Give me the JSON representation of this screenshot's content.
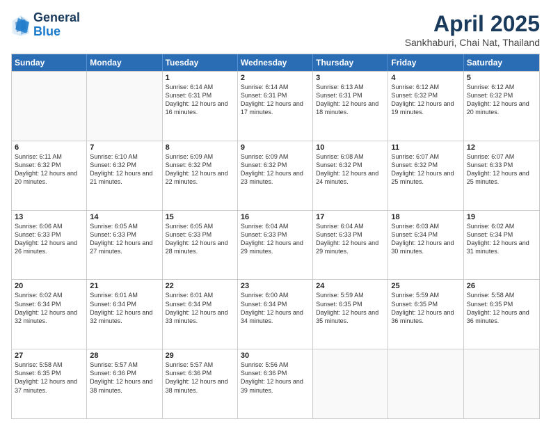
{
  "header": {
    "logo_general": "General",
    "logo_blue": "Blue",
    "title": "April 2025",
    "location": "Sankhaburi, Chai Nat, Thailand"
  },
  "days_of_week": [
    "Sunday",
    "Monday",
    "Tuesday",
    "Wednesday",
    "Thursday",
    "Friday",
    "Saturday"
  ],
  "weeks": [
    [
      {
        "day": "",
        "info": ""
      },
      {
        "day": "",
        "info": ""
      },
      {
        "day": "1",
        "info": "Sunrise: 6:14 AM\nSunset: 6:31 PM\nDaylight: 12 hours and 16 minutes."
      },
      {
        "day": "2",
        "info": "Sunrise: 6:14 AM\nSunset: 6:31 PM\nDaylight: 12 hours and 17 minutes."
      },
      {
        "day": "3",
        "info": "Sunrise: 6:13 AM\nSunset: 6:31 PM\nDaylight: 12 hours and 18 minutes."
      },
      {
        "day": "4",
        "info": "Sunrise: 6:12 AM\nSunset: 6:32 PM\nDaylight: 12 hours and 19 minutes."
      },
      {
        "day": "5",
        "info": "Sunrise: 6:12 AM\nSunset: 6:32 PM\nDaylight: 12 hours and 20 minutes."
      }
    ],
    [
      {
        "day": "6",
        "info": "Sunrise: 6:11 AM\nSunset: 6:32 PM\nDaylight: 12 hours and 20 minutes."
      },
      {
        "day": "7",
        "info": "Sunrise: 6:10 AM\nSunset: 6:32 PM\nDaylight: 12 hours and 21 minutes."
      },
      {
        "day": "8",
        "info": "Sunrise: 6:09 AM\nSunset: 6:32 PM\nDaylight: 12 hours and 22 minutes."
      },
      {
        "day": "9",
        "info": "Sunrise: 6:09 AM\nSunset: 6:32 PM\nDaylight: 12 hours and 23 minutes."
      },
      {
        "day": "10",
        "info": "Sunrise: 6:08 AM\nSunset: 6:32 PM\nDaylight: 12 hours and 24 minutes."
      },
      {
        "day": "11",
        "info": "Sunrise: 6:07 AM\nSunset: 6:32 PM\nDaylight: 12 hours and 25 minutes."
      },
      {
        "day": "12",
        "info": "Sunrise: 6:07 AM\nSunset: 6:33 PM\nDaylight: 12 hours and 25 minutes."
      }
    ],
    [
      {
        "day": "13",
        "info": "Sunrise: 6:06 AM\nSunset: 6:33 PM\nDaylight: 12 hours and 26 minutes."
      },
      {
        "day": "14",
        "info": "Sunrise: 6:05 AM\nSunset: 6:33 PM\nDaylight: 12 hours and 27 minutes."
      },
      {
        "day": "15",
        "info": "Sunrise: 6:05 AM\nSunset: 6:33 PM\nDaylight: 12 hours and 28 minutes."
      },
      {
        "day": "16",
        "info": "Sunrise: 6:04 AM\nSunset: 6:33 PM\nDaylight: 12 hours and 29 minutes."
      },
      {
        "day": "17",
        "info": "Sunrise: 6:04 AM\nSunset: 6:33 PM\nDaylight: 12 hours and 29 minutes."
      },
      {
        "day": "18",
        "info": "Sunrise: 6:03 AM\nSunset: 6:34 PM\nDaylight: 12 hours and 30 minutes."
      },
      {
        "day": "19",
        "info": "Sunrise: 6:02 AM\nSunset: 6:34 PM\nDaylight: 12 hours and 31 minutes."
      }
    ],
    [
      {
        "day": "20",
        "info": "Sunrise: 6:02 AM\nSunset: 6:34 PM\nDaylight: 12 hours and 32 minutes."
      },
      {
        "day": "21",
        "info": "Sunrise: 6:01 AM\nSunset: 6:34 PM\nDaylight: 12 hours and 32 minutes."
      },
      {
        "day": "22",
        "info": "Sunrise: 6:01 AM\nSunset: 6:34 PM\nDaylight: 12 hours and 33 minutes."
      },
      {
        "day": "23",
        "info": "Sunrise: 6:00 AM\nSunset: 6:34 PM\nDaylight: 12 hours and 34 minutes."
      },
      {
        "day": "24",
        "info": "Sunrise: 5:59 AM\nSunset: 6:35 PM\nDaylight: 12 hours and 35 minutes."
      },
      {
        "day": "25",
        "info": "Sunrise: 5:59 AM\nSunset: 6:35 PM\nDaylight: 12 hours and 36 minutes."
      },
      {
        "day": "26",
        "info": "Sunrise: 5:58 AM\nSunset: 6:35 PM\nDaylight: 12 hours and 36 minutes."
      }
    ],
    [
      {
        "day": "27",
        "info": "Sunrise: 5:58 AM\nSunset: 6:35 PM\nDaylight: 12 hours and 37 minutes."
      },
      {
        "day": "28",
        "info": "Sunrise: 5:57 AM\nSunset: 6:36 PM\nDaylight: 12 hours and 38 minutes."
      },
      {
        "day": "29",
        "info": "Sunrise: 5:57 AM\nSunset: 6:36 PM\nDaylight: 12 hours and 38 minutes."
      },
      {
        "day": "30",
        "info": "Sunrise: 5:56 AM\nSunset: 6:36 PM\nDaylight: 12 hours and 39 minutes."
      },
      {
        "day": "",
        "info": ""
      },
      {
        "day": "",
        "info": ""
      },
      {
        "day": "",
        "info": ""
      }
    ]
  ]
}
